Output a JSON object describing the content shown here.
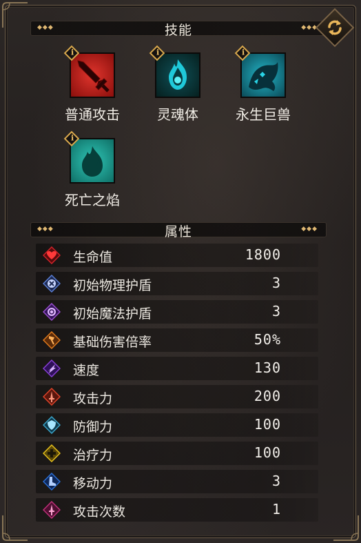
{
  "skills_header": {
    "title": "技能"
  },
  "skills": [
    {
      "label": "普通攻击",
      "icon": "sword-icon",
      "color": "#c0211b"
    },
    {
      "label": "灵魂体",
      "icon": "soul-flame-icon",
      "color": "#0f6f78"
    },
    {
      "label": "永生巨兽",
      "icon": "beast-icon",
      "color": "#0e7c8f"
    },
    {
      "label": "死亡之焰",
      "icon": "death-flame-icon",
      "color": "#1f8f86"
    }
  ],
  "info_badge": "i",
  "attributes_header": {
    "title": "属性"
  },
  "attributes": [
    {
      "name": "生命值",
      "value": "1800",
      "icon": "heart-icon",
      "color": "#d2232a"
    },
    {
      "name": "初始物理护盾",
      "value": "3",
      "icon": "physical-shield-icon",
      "color": "#5a7fd6"
    },
    {
      "name": "初始魔法护盾",
      "value": "3",
      "icon": "magic-shield-icon",
      "color": "#9b4fd1"
    },
    {
      "name": "基础伤害倍率",
      "value": "50%",
      "icon": "axe-icon",
      "color": "#e07a1c"
    },
    {
      "name": "速度",
      "value": "130",
      "icon": "speed-icon",
      "color": "#8a3fd8"
    },
    {
      "name": "攻击力",
      "value": "200",
      "icon": "attack-icon",
      "color": "#e0442a"
    },
    {
      "name": "防御力",
      "value": "100",
      "icon": "defense-icon",
      "color": "#3aa4c9"
    },
    {
      "name": "治疗力",
      "value": "100",
      "icon": "heal-icon",
      "color": "#e8c21c"
    },
    {
      "name": "移动力",
      "value": "3",
      "icon": "boot-icon",
      "color": "#2a6fd8"
    },
    {
      "name": "攻击次数",
      "value": "1",
      "icon": "attack-count-icon",
      "color": "#c0307a"
    }
  ]
}
